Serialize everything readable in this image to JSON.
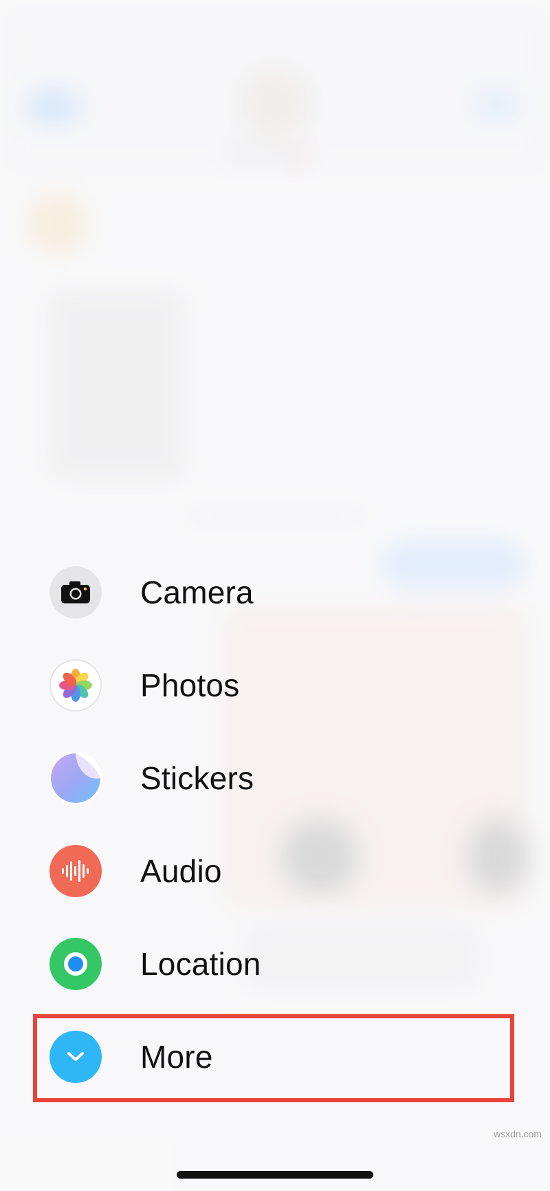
{
  "menu": {
    "items": [
      {
        "label": "Camera",
        "icon": "camera-icon"
      },
      {
        "label": "Photos",
        "icon": "photos-icon"
      },
      {
        "label": "Stickers",
        "icon": "stickers-icon"
      },
      {
        "label": "Audio",
        "icon": "audio-waveform-icon"
      },
      {
        "label": "Location",
        "icon": "location-icon"
      },
      {
        "label": "More",
        "icon": "chevron-down-icon"
      }
    ],
    "highlighted_item": "More"
  },
  "colors": {
    "highlight_border": "#e8443c",
    "audio": "#f06a55",
    "location": "#35c766",
    "more": "#2fb7f5"
  },
  "watermark": "wsxdn.com"
}
